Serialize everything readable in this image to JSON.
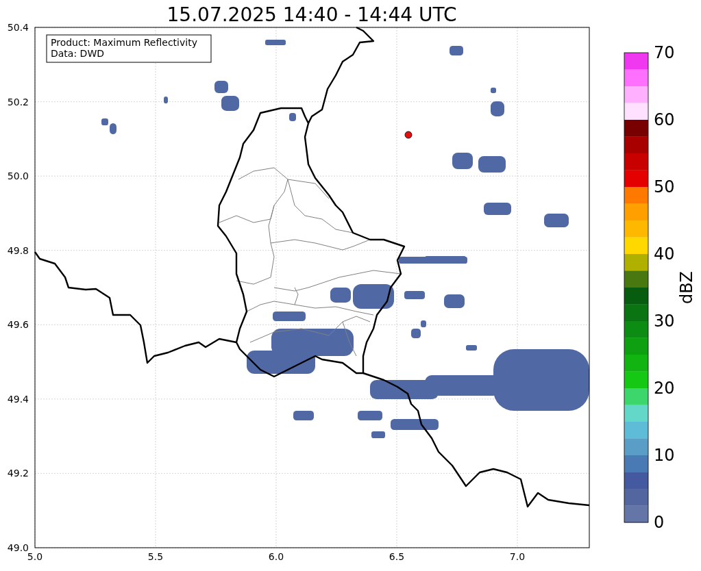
{
  "title": "15.07.2025 14:40 - 14:44 UTC",
  "info_box": [
    "Product: Maximum Reflectivity",
    "Data: DWD"
  ],
  "x_ticks": [
    "5.0",
    "5.5",
    "6.0",
    "6.5",
    "7.0"
  ],
  "y_ticks": [
    "50.4",
    "50.2",
    "50.0",
    "49.8",
    "49.6",
    "49.4",
    "49.2",
    "49.0"
  ],
  "colorbar": {
    "label": "dBZ",
    "ticks": [
      "70",
      "60",
      "50",
      "40",
      "30",
      "20",
      "10",
      "0"
    ],
    "segments": [
      {
        "color": "#f038f0"
      },
      {
        "color": "#ff70ff"
      },
      {
        "color": "#ffb0ff"
      },
      {
        "color": "#ffe0ff"
      },
      {
        "color": "#780000"
      },
      {
        "color": "#a80000"
      },
      {
        "color": "#c80000"
      },
      {
        "color": "#e40000"
      },
      {
        "color": "#ff7800"
      },
      {
        "color": "#ffa000"
      },
      {
        "color": "#ffb800"
      },
      {
        "color": "#ffd800"
      },
      {
        "color": "#b0b000"
      },
      {
        "color": "#4a7810"
      },
      {
        "color": "#085c10"
      },
      {
        "color": "#0a7412"
      },
      {
        "color": "#0c8c12"
      },
      {
        "color": "#0fa012"
      },
      {
        "color": "#12b412"
      },
      {
        "color": "#14c814"
      },
      {
        "color": "#3cd66c"
      },
      {
        "color": "#64d8c8"
      },
      {
        "color": "#5ebcd8"
      },
      {
        "color": "#5a9ec8"
      },
      {
        "color": "#4a7ab4"
      },
      {
        "color": "#4459a0"
      },
      {
        "color": "#5466a0"
      },
      {
        "color": "#6476a8"
      }
    ]
  }
}
